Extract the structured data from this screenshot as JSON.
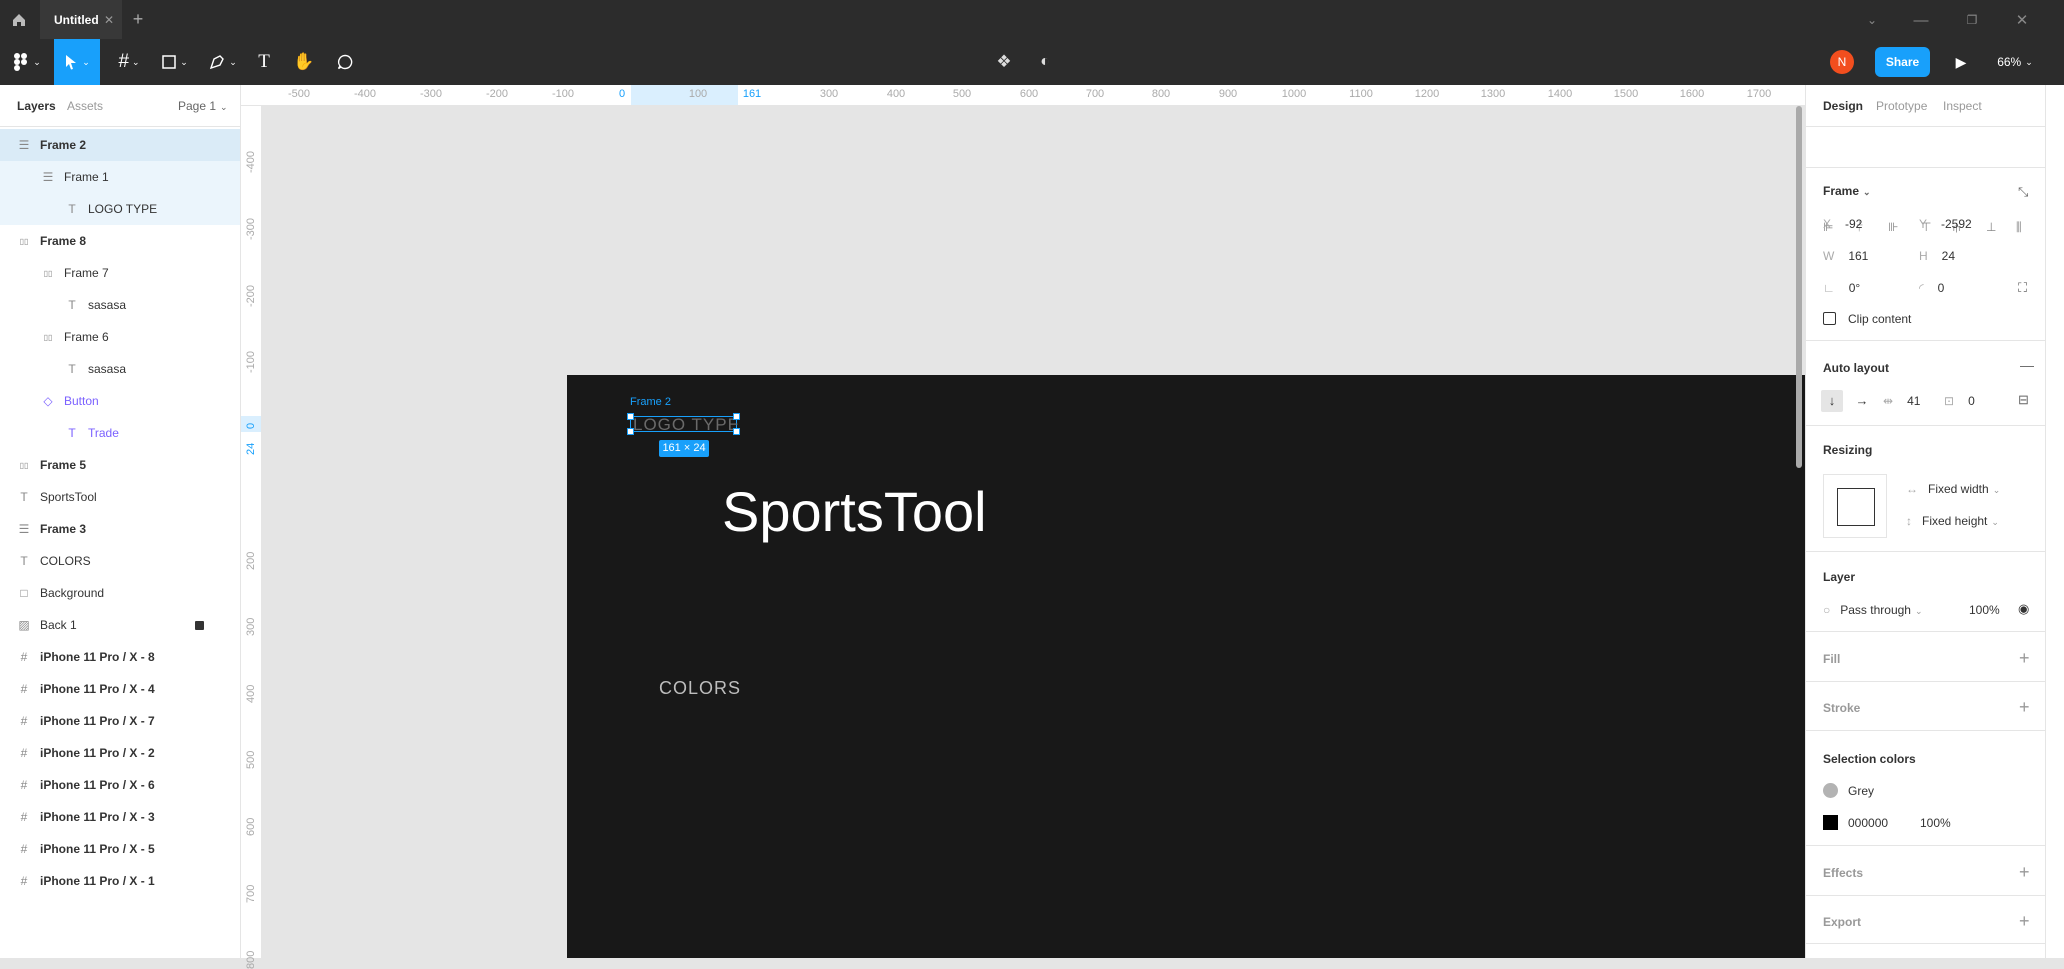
{
  "app": {
    "tab_title": "Untitled",
    "zoom": "66%",
    "share_label": "Share",
    "avatar_initial": "N"
  },
  "left_panel": {
    "tabs": [
      "Layers",
      "Assets"
    ],
    "page": "Page 1",
    "layers": [
      {
        "label": "Frame 2",
        "icon": "autolayout-vertical-icon",
        "level": 0,
        "bold": true,
        "selected": true
      },
      {
        "label": "Frame 1",
        "icon": "autolayout-vertical-icon",
        "level": 1,
        "bold": false,
        "child_selected": true
      },
      {
        "label": "LOGO TYPE",
        "icon": "text-icon",
        "level": 2,
        "bold": false,
        "child_selected": true
      },
      {
        "label": "Frame 8",
        "icon": "autolayout-horizontal-icon",
        "level": 0,
        "bold": true
      },
      {
        "label": "Frame 7",
        "icon": "autolayout-horizontal-icon",
        "level": 1,
        "bold": false
      },
      {
        "label": "sasasa",
        "icon": "text-icon",
        "level": 2,
        "bold": false
      },
      {
        "label": "Frame 6",
        "icon": "autolayout-horizontal-icon",
        "level": 1,
        "bold": false
      },
      {
        "label": "sasasa",
        "icon": "text-icon",
        "level": 2,
        "bold": false
      },
      {
        "label": "Button",
        "icon": "component-instance-icon",
        "level": 1,
        "bold": false,
        "component": true
      },
      {
        "label": "Trade",
        "icon": "text-icon",
        "level": 2,
        "bold": false,
        "component": true
      },
      {
        "label": "Frame 5",
        "icon": "autolayout-horizontal-icon",
        "level": 0,
        "bold": true
      },
      {
        "label": "SportsTool",
        "icon": "text-icon",
        "level": 0,
        "bold": false
      },
      {
        "label": "Frame 3",
        "icon": "autolayout-vertical-icon",
        "level": 0,
        "bold": true
      },
      {
        "label": "COLORS",
        "icon": "text-icon",
        "level": 0,
        "bold": false
      },
      {
        "label": "Background",
        "icon": "rectangle-icon",
        "level": 0,
        "bold": false
      },
      {
        "label": "Back 1",
        "icon": "image-icon",
        "level": 0,
        "bold": false,
        "locked": true
      },
      {
        "label": "iPhone 11 Pro / X - 8",
        "icon": "frame-icon",
        "level": 0,
        "bold": true
      },
      {
        "label": "iPhone 11 Pro / X - 4",
        "icon": "frame-icon",
        "level": 0,
        "bold": true
      },
      {
        "label": "iPhone 11 Pro / X - 7",
        "icon": "frame-icon",
        "level": 0,
        "bold": true
      },
      {
        "label": "iPhone 11 Pro / X - 2",
        "icon": "frame-icon",
        "level": 0,
        "bold": true
      },
      {
        "label": "iPhone 11 Pro / X - 6",
        "icon": "frame-icon",
        "level": 0,
        "bold": true
      },
      {
        "label": "iPhone 11 Pro / X - 3",
        "icon": "frame-icon",
        "level": 0,
        "bold": true
      },
      {
        "label": "iPhone 11 Pro / X - 5",
        "icon": "frame-icon",
        "level": 0,
        "bold": true
      },
      {
        "label": "iPhone 11 Pro / X - 1",
        "icon": "frame-icon",
        "level": 0,
        "bold": true
      }
    ]
  },
  "rulers": {
    "top": [
      "-500",
      "-400",
      "-300",
      "-200",
      "-100",
      "0",
      "100",
      "161",
      "300",
      "400",
      "500",
      "600",
      "700",
      "800",
      "900",
      "1000",
      "1100",
      "1200",
      "1300",
      "1400",
      "1500",
      "1600",
      "1700"
    ],
    "left": [
      "-400",
      "-300",
      "-200",
      "-100",
      "0",
      "24",
      "200",
      "300",
      "400",
      "500",
      "600",
      "700",
      "800"
    ]
  },
  "canvas": {
    "frame_label": "Frame 2",
    "logo_text": "LOGO TYPE",
    "size_badge": "161 × 24",
    "title_text": "SportsTool",
    "colors_text": "COLORS"
  },
  "right_panel": {
    "tabs": [
      "Design",
      "Prototype",
      "Inspect"
    ],
    "frame": {
      "title": "Frame",
      "x_label": "X",
      "x": "-92",
      "y_label": "Y",
      "y": "-2592",
      "w_label": "W",
      "w": "161",
      "h_label": "H",
      "h": "24",
      "rotation": "0°",
      "radius": "0",
      "clip_label": "Clip content"
    },
    "auto_layout": {
      "title": "Auto layout",
      "spacing": "41",
      "padding": "0"
    },
    "resizing": {
      "title": "Resizing",
      "width": "Fixed width",
      "height": "Fixed height"
    },
    "layer": {
      "title": "Layer",
      "blend": "Pass through",
      "opacity": "100%"
    },
    "fill": {
      "title": "Fill"
    },
    "stroke": {
      "title": "Stroke"
    },
    "selection_colors": {
      "title": "Selection colors",
      "items": [
        {
          "name": "Grey",
          "color": "#b3b3b3",
          "opacity": ""
        },
        {
          "name": "000000",
          "color": "#000000",
          "opacity": "100%"
        }
      ]
    },
    "effects": {
      "title": "Effects"
    },
    "export": {
      "title": "Export"
    }
  },
  "colors": {
    "accent": "#18a0fb",
    "toolbar_bg": "#2c2c2c",
    "frame_bg": "#181818",
    "component": "#7b61ff",
    "avatar": "#f24e1e"
  }
}
